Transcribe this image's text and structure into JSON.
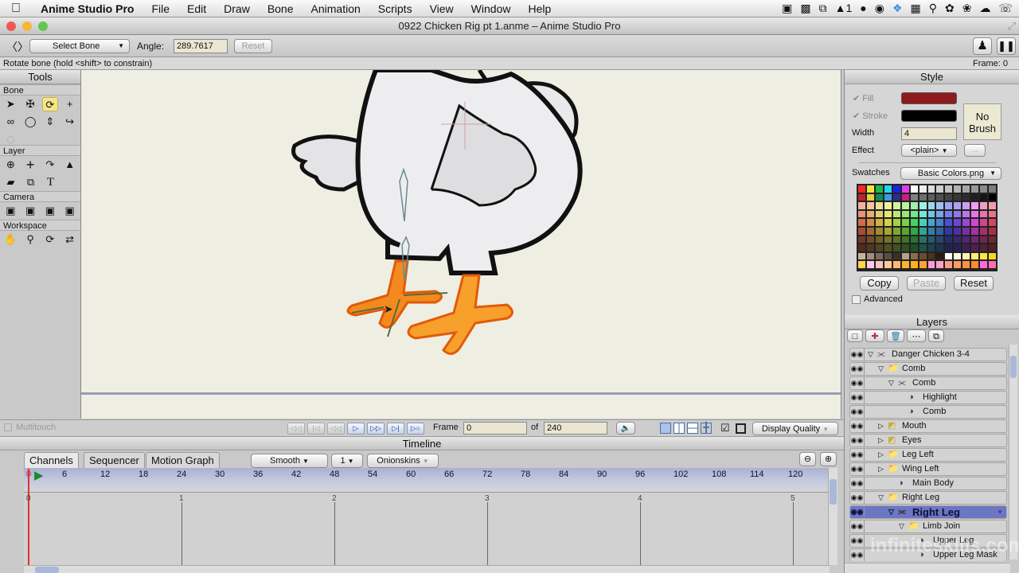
{
  "menubar": {
    "app_name": "Anime Studio Pro",
    "items": [
      "File",
      "Edit",
      "Draw",
      "Bone",
      "Animation",
      "Scripts",
      "View",
      "Window",
      "Help"
    ],
    "tray_badge": "1"
  },
  "window": {
    "title": "0922 Chicken Rig pt 1.anme – Anime Studio Pro"
  },
  "toolbar": {
    "mode_select": "Select Bone",
    "angle_label": "Angle:",
    "angle_value": "289.7617",
    "reset_label": "Reset"
  },
  "status": {
    "hint": "Rotate bone (hold <shift> to constrain)",
    "frame": "Frame: 0"
  },
  "tools": {
    "title": "Tools",
    "sections": [
      {
        "label": "Bone",
        "icons": [
          "select-bone",
          "translate-bone",
          "rotate-bone",
          "add-bone",
          "reparent-bone",
          "bone-strength",
          "manipulate-bones",
          "bind-layer",
          "offset-bone"
        ]
      },
      {
        "label": "Layer",
        "icons": [
          "translate-layer",
          "set-origin",
          "rotate-layer",
          "scale-layer",
          "shear-layer",
          "switch-layer",
          "insert-text"
        ]
      },
      {
        "label": "Camera",
        "icons": [
          "track-camera",
          "zoom-camera",
          "roll-camera",
          "pan-tilt-camera"
        ]
      },
      {
        "label": "Workspace",
        "icons": [
          "pan-workspace",
          "zoom-workspace",
          "rotate-workspace",
          "orbit-workspace"
        ]
      }
    ]
  },
  "style": {
    "title": "Style",
    "fill_label": "Fill",
    "stroke_label": "Stroke",
    "fill_color": "#8e1a1e",
    "stroke_color": "#000000",
    "width_label": "Width",
    "width_value": "4",
    "effect_label": "Effect",
    "effect_value": "<plain>",
    "effect_more": "...",
    "brush_label": "No Brush",
    "swatches_label": "Swatches",
    "swatches_value": "Basic Colors.png",
    "copy_label": "Copy",
    "paste_label": "Paste",
    "reset_label": "Reset",
    "advanced_label": "Advanced"
  },
  "layers": {
    "title": "Layers",
    "items": [
      {
        "name": "Danger Chicken 3-4",
        "type": "bone",
        "depth": 0,
        "expanded": true
      },
      {
        "name": "Comb",
        "type": "group",
        "depth": 1,
        "expanded": true
      },
      {
        "name": "Comb",
        "type": "bone",
        "depth": 2,
        "expanded": true
      },
      {
        "name": "Highlight",
        "type": "vector",
        "depth": 3
      },
      {
        "name": "Comb",
        "type": "vector",
        "depth": 3
      },
      {
        "name": "Mouth",
        "type": "switch",
        "depth": 1,
        "expanded": false
      },
      {
        "name": "Eyes",
        "type": "switch",
        "depth": 1,
        "expanded": false
      },
      {
        "name": "Leg Left",
        "type": "group",
        "depth": 1,
        "expanded": false
      },
      {
        "name": "Wing Left",
        "type": "group",
        "depth": 1,
        "expanded": false
      },
      {
        "name": "Main Body",
        "type": "vector",
        "depth": 2
      },
      {
        "name": "Right Leg",
        "type": "group",
        "depth": 1,
        "expanded": true
      },
      {
        "name": "Right Leg",
        "type": "bone",
        "depth": 2,
        "expanded": true,
        "selected": true
      },
      {
        "name": "Limb Join",
        "type": "group",
        "depth": 3,
        "expanded": true
      },
      {
        "name": "Upper Leg",
        "type": "vector",
        "depth": 4
      },
      {
        "name": "Upper Leg Mask",
        "type": "vector",
        "depth": 4
      }
    ]
  },
  "playback": {
    "multitouch_label": "Multitouch",
    "frame_label": "Frame",
    "frame_value": "0",
    "of_label": "of",
    "total_frames": "240",
    "display_quality": "Display Quality"
  },
  "timeline": {
    "title": "Timeline",
    "tabs": [
      "Channels",
      "Sequencer",
      "Motion Graph"
    ],
    "interpolation": "Smooth",
    "step": "1",
    "onionskins": "Onionskins",
    "ruler_ticks": [
      "6",
      "12",
      "18",
      "24",
      "30",
      "36",
      "42",
      "48",
      "54",
      "60",
      "66",
      "72",
      "78",
      "84",
      "90",
      "96",
      "102",
      "108",
      "114",
      "120"
    ],
    "seconds": [
      "0",
      "1",
      "2",
      "3",
      "4",
      "5"
    ],
    "current_marker": "0"
  },
  "watermark": "infiniteskills.com"
}
